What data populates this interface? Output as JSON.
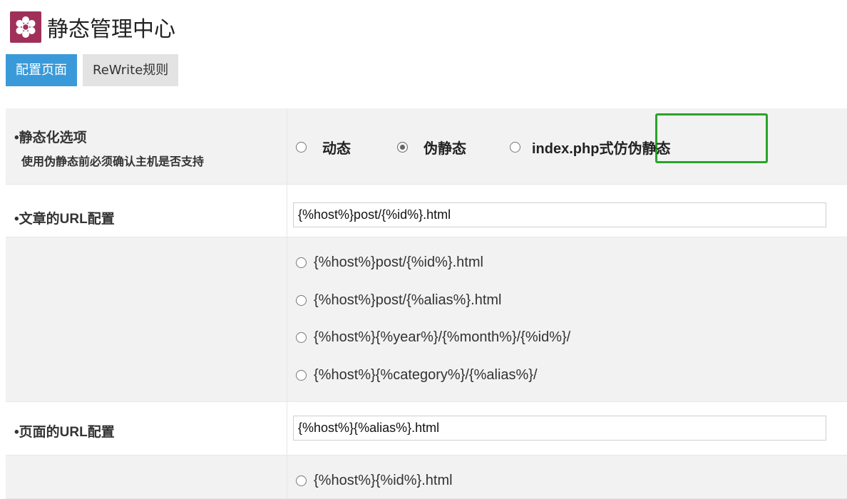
{
  "header": {
    "title": "静态管理中心",
    "logo_icon": "honeycomb-logo-icon",
    "logo_color": "#a0305a"
  },
  "tabs": [
    {
      "label": "配置页面",
      "active": true
    },
    {
      "label": "ReWrite规则",
      "active": false
    }
  ],
  "static_option": {
    "label": "•静态化选项",
    "sublabel": "使用伪静态前必须确认主机是否支持",
    "options": [
      {
        "label": "动态",
        "checked": false
      },
      {
        "label": "伪静态",
        "checked": true
      },
      {
        "label": "index.php式仿伪静态",
        "checked": false
      }
    ],
    "highlight_color": "#28a428"
  },
  "article_url": {
    "label": "•文章的URL配置",
    "value": "{%host%}post/{%id%}.html",
    "options": [
      "{%host%}post/{%id%}.html",
      "{%host%}post/{%alias%}.html",
      "{%host%}{%year%}/{%month%}/{%id%}/",
      "{%host%}{%category%}/{%alias%}/"
    ]
  },
  "page_url": {
    "label": "•页面的URL配置",
    "value": "{%host%}{%alias%}.html",
    "options": [
      "{%host%}{%id%}.html"
    ]
  }
}
